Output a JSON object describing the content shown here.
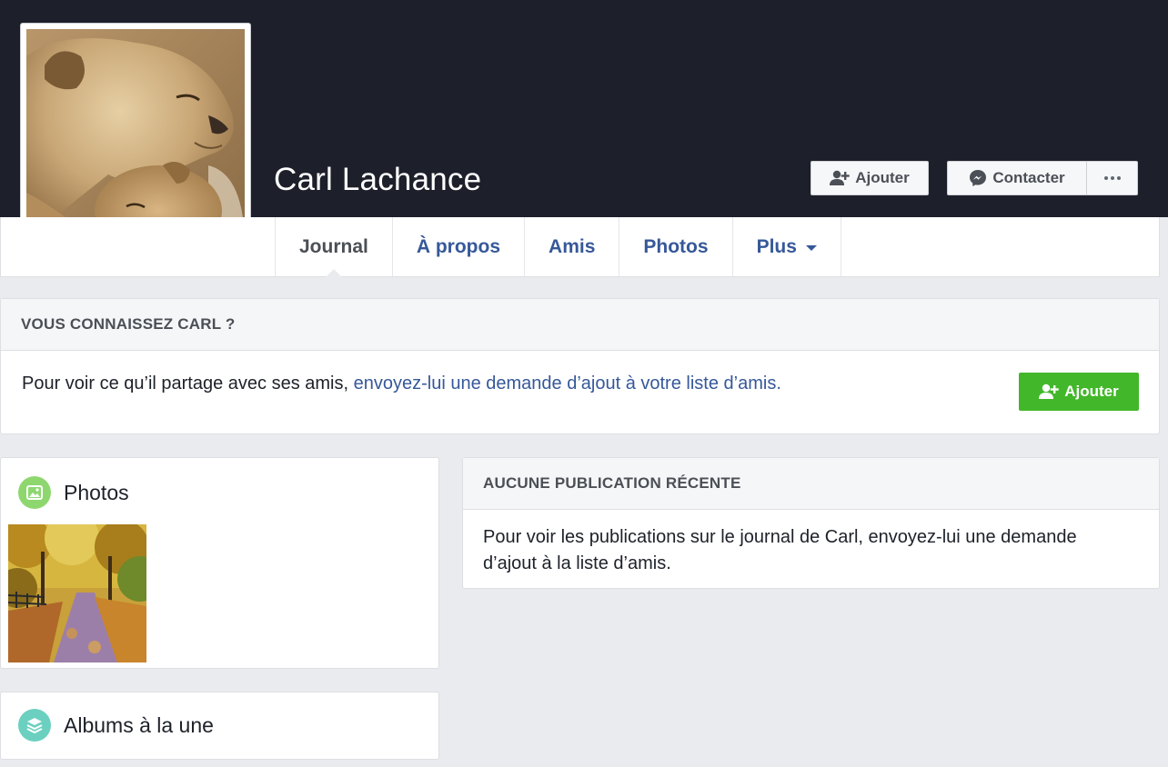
{
  "profile": {
    "name": "Carl Lachance",
    "avatar_icon": "lioness-and-cub-photo"
  },
  "actions": {
    "add_label": "Ajouter",
    "contact_label": "Contacter"
  },
  "tabs": [
    {
      "label": "Journal",
      "active": true
    },
    {
      "label": "À propos",
      "active": false
    },
    {
      "label": "Amis",
      "active": false
    },
    {
      "label": "Photos",
      "active": false
    },
    {
      "label": "Plus",
      "active": false
    }
  ],
  "know_card": {
    "title": "VOUS CONNAISSEZ CARL ?",
    "text_prefix": "Pour voir ce qu’il partage avec ses amis, ",
    "text_link": "envoyez-lui une demande d’ajout à votre liste d’amis.",
    "button_label": "Ajouter"
  },
  "photos_section": {
    "title": "Photos",
    "thumbnail_icon": "autumn-forest-path-photo"
  },
  "albums_section": {
    "title": "Albums à la une"
  },
  "recent_card": {
    "title": "AUCUNE PUBLICATION RÉCENTE",
    "text": "Pour voir les publications sur le journal de Carl, envoyez-lui une demande d’ajout à la liste d’amis."
  },
  "colors": {
    "cover": "#1d202a",
    "link": "#365899",
    "green": "#42b72a",
    "photos_icon_bg": "#8ed76f",
    "albums_icon_bg": "#6bd0bf"
  }
}
